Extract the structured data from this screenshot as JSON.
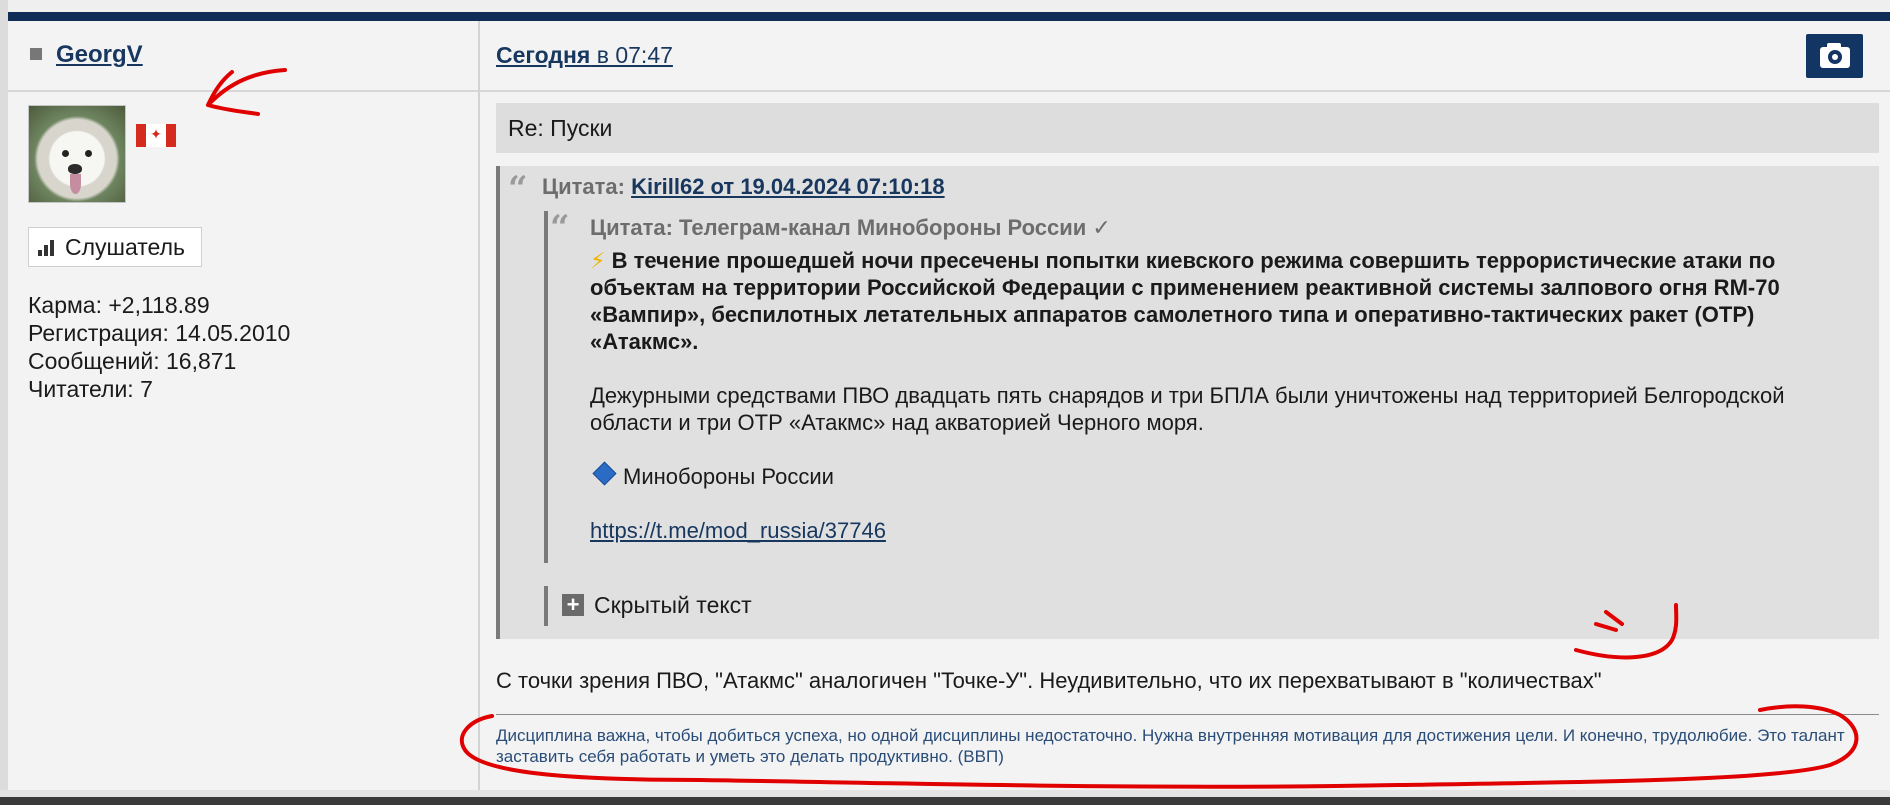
{
  "user": {
    "username": "GeorgV",
    "rank": "Слушатель",
    "stats": [
      "Карма: +2,118.89",
      "Регистрация: 14.05.2010",
      "Сообщений: 16,871",
      "Читатели: 7"
    ]
  },
  "post": {
    "date_day": "Сегодня",
    "date_time": " в 07:47",
    "subject": "Re: Пуски",
    "quote_outer_label": "Цитата: ",
    "quote_outer_author": "Kirill62 от 19.04.2024 07:10:18",
    "quote_inner_title": "Цитата: Телеграм-канал Минобороны России ✓",
    "quote_bolt": "⚡",
    "quote_bold_text": "В течение прошедшей ночи пресечены попытки киевского режима совершить террористические атаки по объектам на территории Российской Федерации с применением реактивной системы залпового огня RM-70 «Вампир», беспилотных летательных аппаратов самолетного типа и оперативно-тактических ракет (ОТР) «Атакмс».",
    "quote_paragraph": "Дежурными средствами ПВО двадцать пять снарядов и три БПЛА были уничтожены над территорией Белгородской области и три ОТР «Атакмс» над акваторией Черного моря.",
    "quote_source": "Минобороны России",
    "quote_link": "https://t.me/mod_russia/37746",
    "spoiler_label": "Скрытый текст",
    "text": "С точки зрения ПВО, \"Атакмс\" аналогичен \"Точке-У\". Неудивительно, что их перехватывают в \"количествах\"",
    "signature": "Дисциплина важна, чтобы добиться успеха, но одной дисциплины недостаточно. Нужна внутренняя мотивация для достижения цели. И конечно, трудолюбие. Это талант заставить себя работать и уметь это делать продуктивно. (ВВП)"
  },
  "icons": {
    "camera": "camera-icon",
    "rank": "signal-bars-icon",
    "spoiler": "plus-icon",
    "quote": "quote-icon",
    "source": "blue-diamond-icon",
    "flag": "canada-flag"
  },
  "colors": {
    "header_bar": "#0f2d57",
    "link": "#17375e",
    "annotation": "#e00000",
    "bolt": "#f0b400"
  }
}
